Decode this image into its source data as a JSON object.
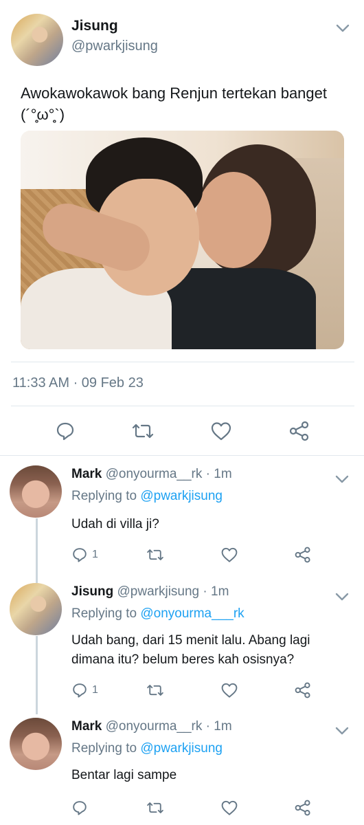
{
  "tweet": {
    "author_name": "Jisung",
    "author_handle": "@pwarkjisung",
    "text": "Awokawokawok bang Renjun tertekan banget (´°̥̥̥ω°̥̥̥`)",
    "timestamp": "11:33 AM · 09 Feb 23"
  },
  "icons": {
    "reply": "reply-icon",
    "retweet": "retweet-icon",
    "like": "heart-icon",
    "share": "share-icon",
    "more": "chevron-down-icon"
  },
  "replies": [
    {
      "name": "Mark",
      "handle": "@onyourma__rk",
      "time": "· 1m",
      "replying_label": "Replying to",
      "replying_to": "@pwarkjisung",
      "text": "Udah di villa ji?",
      "reply_count": "1"
    },
    {
      "name": "Jisung",
      "handle": "@pwarkjisung",
      "time": "· 1m",
      "replying_label": "Replying to",
      "replying_to": "@onyourma___rk",
      "text": "Udah bang, dari 15 menit lalu. Abang lagi dimana itu? belum beres kah osisnya?",
      "reply_count": "1"
    },
    {
      "name": "Mark",
      "handle": "@onyourma__rk",
      "time": "· 1m",
      "replying_label": "Replying to",
      "replying_to": "@pwarkjisung",
      "text": "Bentar lagi sampe",
      "reply_count": ""
    }
  ],
  "colors": {
    "text": "#14171a",
    "secondary": "#657786",
    "link": "#1da1f2",
    "divider": "#e1e8ed"
  }
}
